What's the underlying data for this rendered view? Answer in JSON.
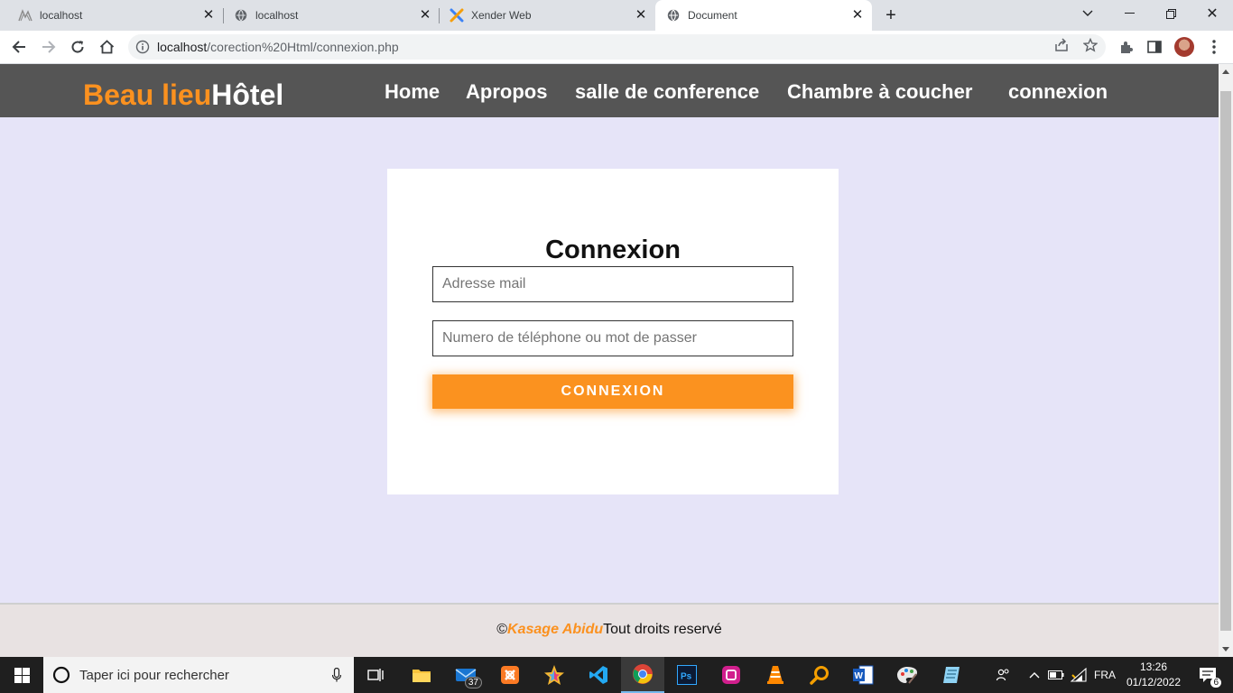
{
  "browser": {
    "tabs": [
      {
        "title": "localhost",
        "icon": "xampp-icon"
      },
      {
        "title": "localhost",
        "icon": "globe-icon"
      },
      {
        "title": "Xender Web",
        "icon": "xender-icon"
      },
      {
        "title": "Document",
        "icon": "globe-icon",
        "active": true
      }
    ],
    "url_host": "localhost",
    "url_path": "/corection%20Html/connexion.php"
  },
  "site": {
    "logo_part1": "Beau lieu",
    "logo_part2": "Hôtel",
    "nav": [
      "Home",
      "Apropos",
      "salle de conference",
      "Chambre à coucher",
      "connexion"
    ],
    "accent": "#fb911f",
    "nav_bg": "#555555",
    "page_bg": "#e6e4f8"
  },
  "form": {
    "title": "Connexion",
    "email_placeholder": "Adresse mail",
    "password_placeholder": "Numero de téléphone ou mot de passer",
    "submit_label": "CONNEXION"
  },
  "footer": {
    "copyright": "©",
    "author": "Kasage Abidu",
    "rights": "Tout droits reservé"
  },
  "taskbar": {
    "search_placeholder": "Taper ici pour rechercher",
    "mail_badge": "37",
    "notif_badge": "6",
    "lang": "FRA",
    "time": "13:26",
    "date": "01/12/2022"
  }
}
